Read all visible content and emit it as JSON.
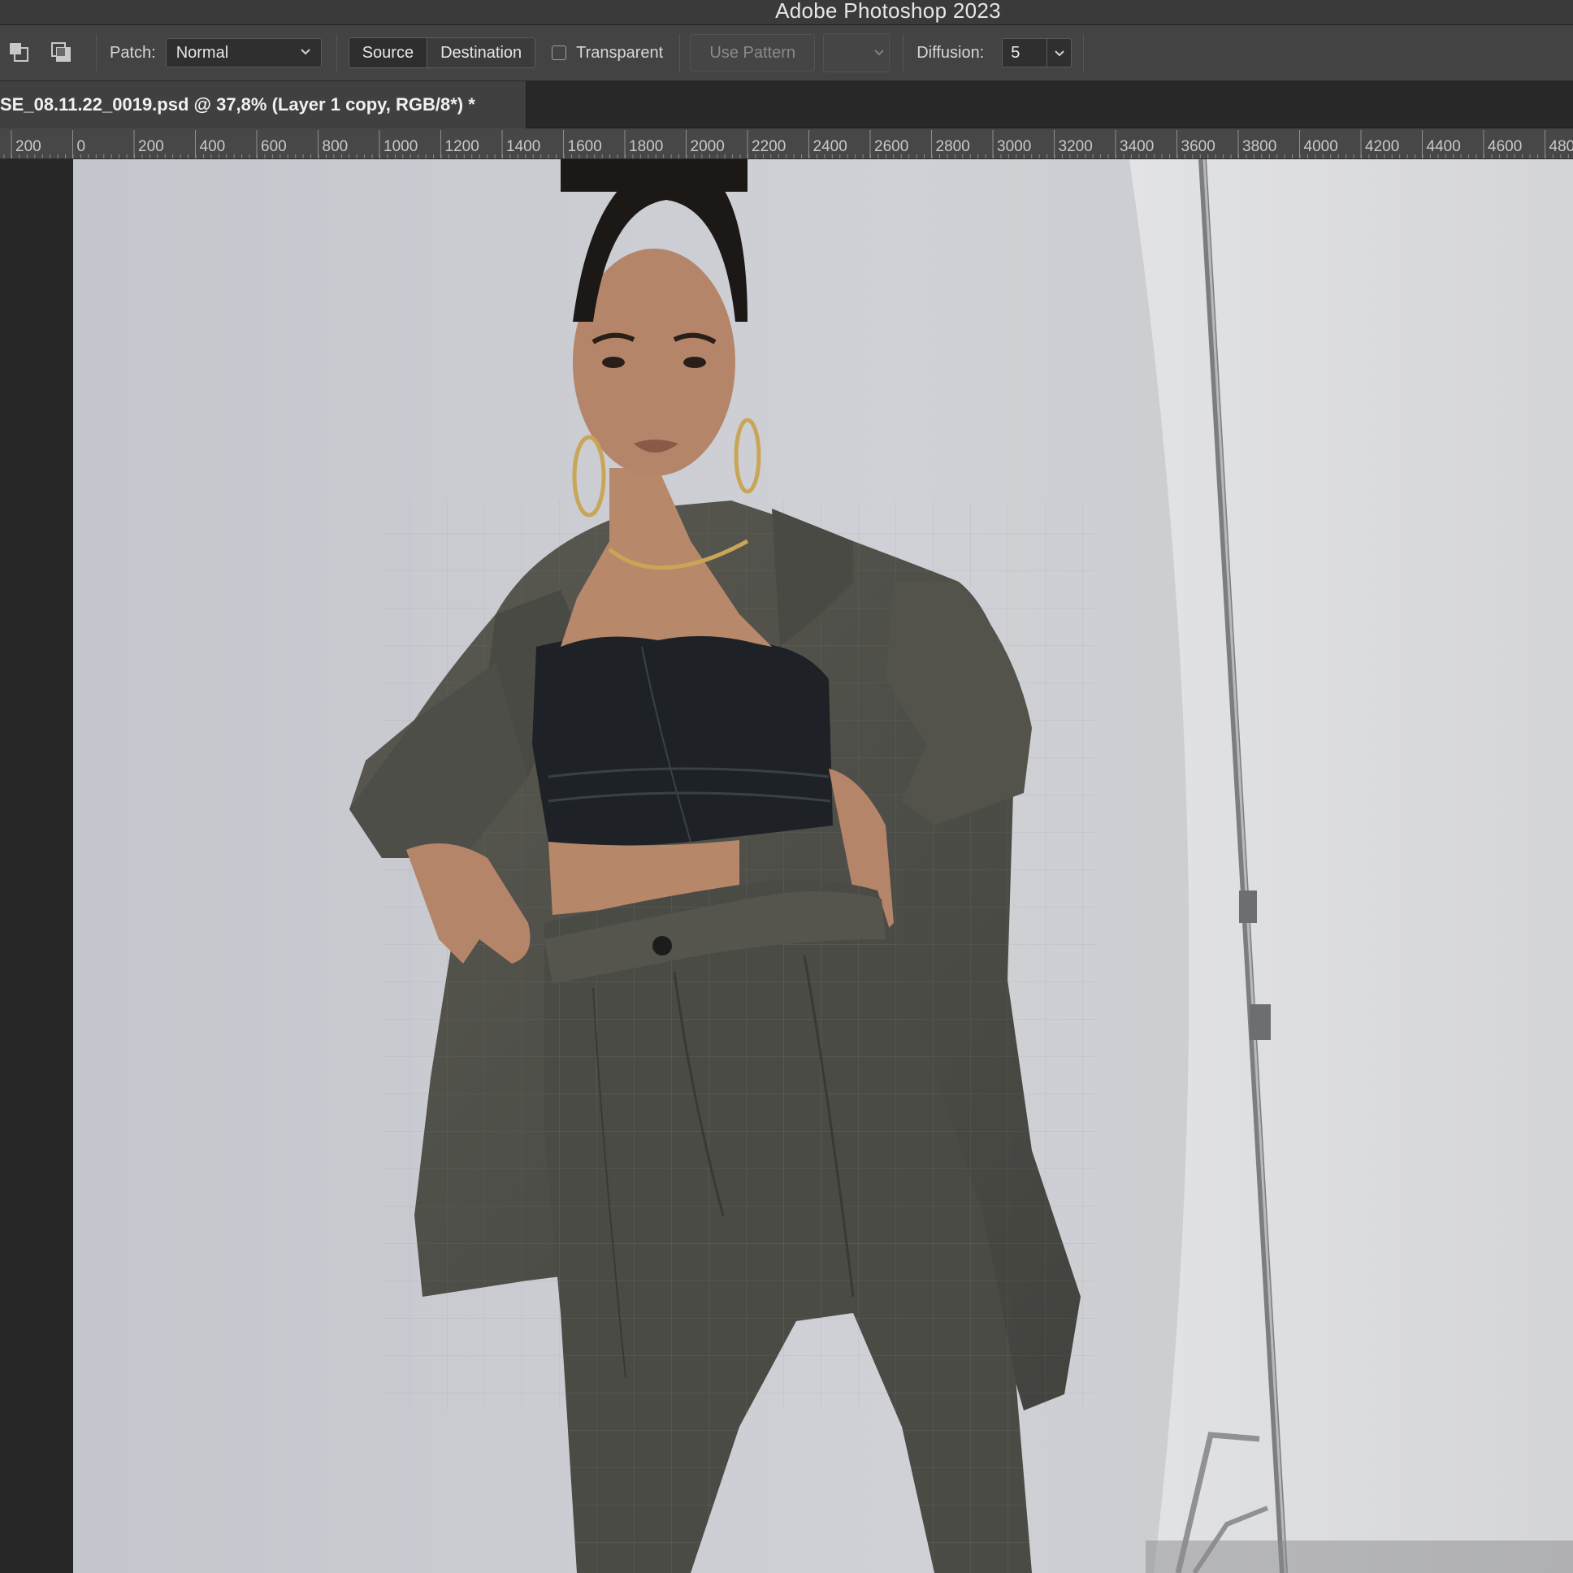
{
  "app": {
    "title": "Adobe Photoshop 2023"
  },
  "options_bar": {
    "patch_label": "Patch:",
    "patch_mode": "Normal",
    "source_label": "Source",
    "destination_label": "Destination",
    "transparent_label": "Transparent",
    "transparent_checked": false,
    "use_pattern_label": "Use Pattern",
    "diffusion_label": "Diffusion:",
    "diffusion_value": "5"
  },
  "document": {
    "tab_title": "SE_08.11.22_0019.psd @ 37,8% (Layer 1 copy, RGB/8*) *"
  },
  "ruler": {
    "labels": [
      "200",
      "0",
      "200",
      "400",
      "600",
      "800",
      "1000",
      "1200",
      "1400",
      "1600",
      "1800",
      "2000",
      "2200",
      "2400",
      "2600",
      "2800",
      "3000",
      "3200",
      "3400",
      "3600",
      "3800",
      "4000",
      "4200",
      "4400",
      "4600",
      "480"
    ]
  },
  "colors": {
    "accent": "#3a3a3a",
    "background_wall": "#c6c7cc",
    "suit": "#4f4f48",
    "top": "#1c2023"
  },
  "icons": {
    "selection_new": "selection-new-icon",
    "selection_add": "selection-add-icon",
    "chevron": "chevron-down-icon"
  }
}
